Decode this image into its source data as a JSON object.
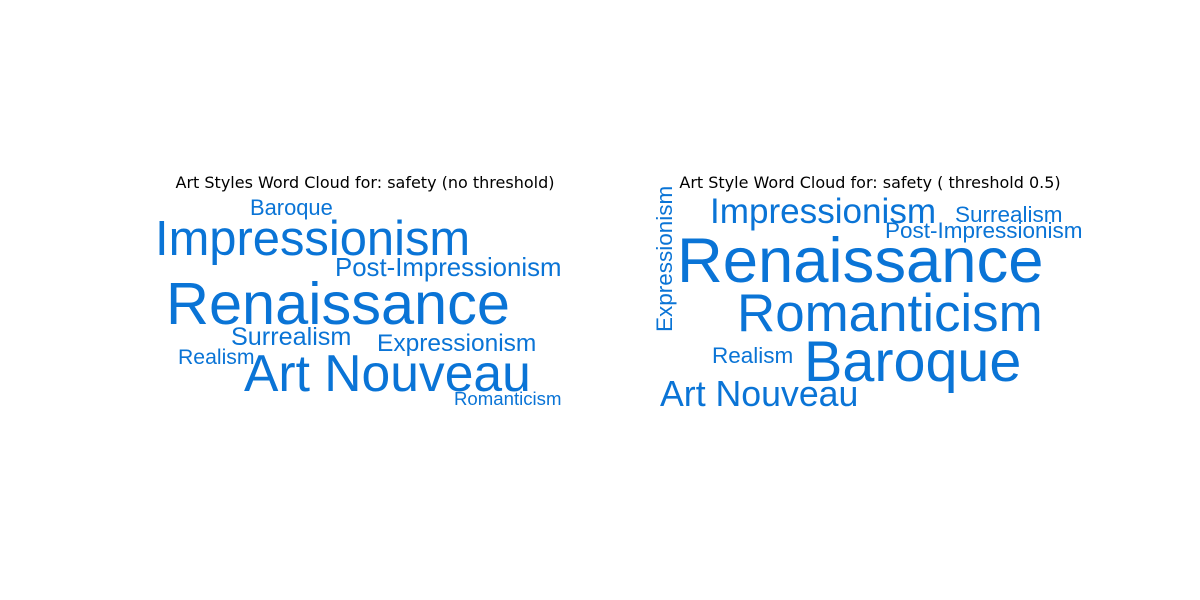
{
  "chart_data": [
    {
      "type": "wordcloud",
      "title": "Art Styles Word Cloud for: safety (no threshold)",
      "color": "#0a74d6",
      "words": [
        {
          "text": "Baroque",
          "weight": 0.21
        },
        {
          "text": "Impressionism",
          "weight": 0.62
        },
        {
          "text": "Post-Impressionism",
          "weight": 0.27
        },
        {
          "text": "Renaissance",
          "weight": 0.78
        },
        {
          "text": "Surrealism",
          "weight": 0.26
        },
        {
          "text": "Expressionism",
          "weight": 0.25
        },
        {
          "text": "Realism",
          "weight": 0.2
        },
        {
          "text": "Art Nouveau",
          "weight": 0.66
        },
        {
          "text": "Romanticism",
          "weight": 0.16
        }
      ]
    },
    {
      "type": "wordcloud",
      "title": "Art Style Word Cloud for: safety ( threshold 0.5)",
      "color": "#0a74d6",
      "words": [
        {
          "text": "Impressionism",
          "weight": 0.41
        },
        {
          "text": "Surrealism",
          "weight": 0.22
        },
        {
          "text": "Post-Impressionism",
          "weight": 0.22
        },
        {
          "text": "Expressionism",
          "weight": 0.22
        },
        {
          "text": "Renaissance",
          "weight": 0.84
        },
        {
          "text": "Romanticism",
          "weight": 0.68
        },
        {
          "text": "Realism",
          "weight": 0.22
        },
        {
          "text": "Baroque",
          "weight": 0.75
        },
        {
          "text": "Art Nouveau",
          "weight": 0.42
        }
      ]
    }
  ]
}
